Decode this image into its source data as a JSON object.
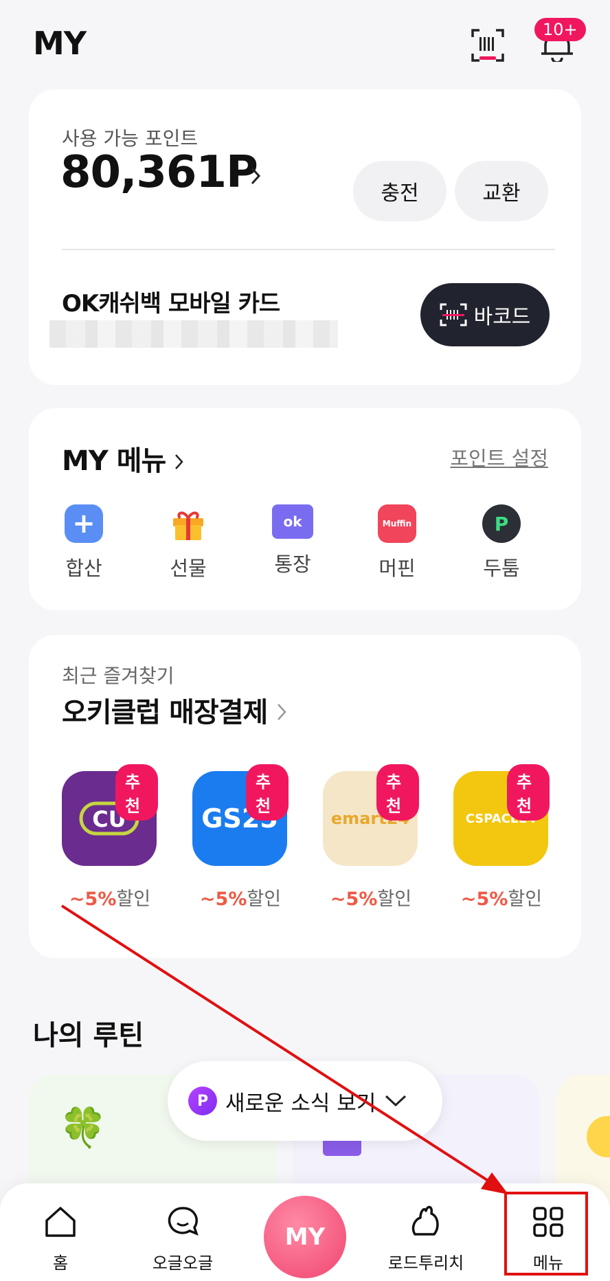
{
  "header": {
    "title": "MY",
    "notification_badge": "10+"
  },
  "points": {
    "label": "사용 가능 포인트",
    "value": "80,361P",
    "charge_label": "충전",
    "exchange_label": "교환",
    "card_name": "OK캐쉬백 모바일 카드",
    "barcode_label": "바코드"
  },
  "my_menu": {
    "title": "MY 메뉴",
    "settings_link": "포인트 설정",
    "items": [
      {
        "label": "합산",
        "icon": "plus-icon",
        "color": "#5b8ef5"
      },
      {
        "label": "선물",
        "icon": "gift-icon",
        "color": "#f6b23a"
      },
      {
        "label": "통장",
        "icon": "passbook-icon",
        "color": "#7a6cf0"
      },
      {
        "label": "머핀",
        "icon": "muffin-icon",
        "color": "#f0455a"
      },
      {
        "label": "두툼",
        "icon": "dootoom-icon",
        "color": "#2c2f36"
      }
    ]
  },
  "favorites": {
    "subtitle": "최근 즐겨찾기",
    "title": "오키클럽 매장결제",
    "stores": [
      {
        "name": "CU",
        "badge": "추천",
        "discount": "~5%",
        "suffix": "할인",
        "color": "#6b2c8f"
      },
      {
        "name": "GS25",
        "badge": "추천",
        "discount": "~5%",
        "suffix": "할인",
        "color": "#1b7cf0"
      },
      {
        "name": "emart24",
        "badge": "추천",
        "discount": "~5%",
        "suffix": "할인",
        "color": "#f5e6c8"
      },
      {
        "name": "CSPACE24",
        "badge": "추천",
        "discount": "~5%",
        "suffix": "할인",
        "color": "#f3c710"
      }
    ]
  },
  "routine": {
    "title": "나의 루틴"
  },
  "news_button": {
    "label": "새로운 소식 보기",
    "icon": "P"
  },
  "bottom_nav": {
    "items": [
      {
        "label": "홈",
        "icon": "home-icon"
      },
      {
        "label": "오글오글",
        "icon": "chat-icon"
      },
      {
        "label": "MY",
        "icon": "my-icon"
      },
      {
        "label": "로드투리치",
        "icon": "rabbit-icon"
      },
      {
        "label": "메뉴",
        "icon": "grid-icon"
      }
    ]
  }
}
